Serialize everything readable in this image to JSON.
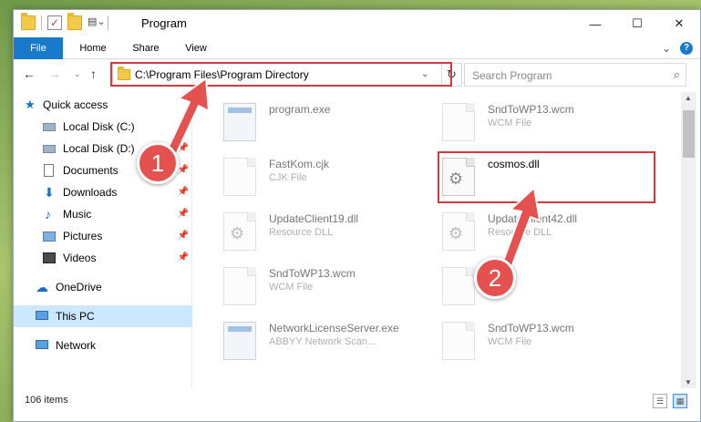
{
  "window": {
    "title": "Program",
    "controls": {
      "minimize": "—",
      "maximize": "☐",
      "close": "✕"
    }
  },
  "ribbon": {
    "tabs": [
      "File",
      "Home",
      "Share",
      "View"
    ],
    "expand_glyph": "⌄",
    "help_glyph": "?"
  },
  "nav": {
    "back": "←",
    "forward": "→",
    "recent": "⌄",
    "up": "↑",
    "address": "C:\\Program Files\\Program Directory",
    "address_chevron": "⌄",
    "refresh": "↻",
    "search_placeholder": "Search Program",
    "search_glyph": "⌕"
  },
  "sidebar": {
    "items": [
      {
        "label": "Quick access",
        "icon": "star-icon",
        "pinned": false
      },
      {
        "label": "Local Disk (C:)",
        "icon": "drive-icon",
        "pinned": true
      },
      {
        "label": "Local Disk (D:)",
        "icon": "drive-icon",
        "pinned": true
      },
      {
        "label": "Documents",
        "icon": "documents-icon",
        "pinned": true
      },
      {
        "label": "Downloads",
        "icon": "download-icon",
        "pinned": true
      },
      {
        "label": "Music",
        "icon": "music-icon",
        "pinned": true
      },
      {
        "label": "Pictures",
        "icon": "pictures-icon",
        "pinned": true
      },
      {
        "label": "Videos",
        "icon": "videos-icon",
        "pinned": true
      },
      {
        "label": "OneDrive",
        "icon": "cloud-icon",
        "pinned": false
      },
      {
        "label": "This PC",
        "icon": "computer-icon",
        "pinned": false,
        "selected": true
      },
      {
        "label": "Network",
        "icon": "network-icon",
        "pinned": false
      }
    ],
    "pin_glyph": "📌"
  },
  "files": [
    {
      "name": "program.exe",
      "type": ""
    },
    {
      "name": "SndToWP13.wcm",
      "type": "WCM File"
    },
    {
      "name": "FastKom.cjk",
      "type": "CJK File"
    },
    {
      "name": "cosmos.dll",
      "type": ""
    },
    {
      "name": "UpdateClient19.dll",
      "type": "Resource DLL"
    },
    {
      "name": "UpdateClient42.dll",
      "type": "Resource DLL"
    },
    {
      "name": "SndToWP13.wcm",
      "type": "WCM File"
    },
    {
      "name": "",
      "type": ""
    },
    {
      "name": "NetworkLicenseServer.exe",
      "type": "ABBYY Network Scan..."
    },
    {
      "name": "SndToWP13.wcm",
      "type": "WCM File"
    }
  ],
  "status": {
    "item_count": "106 items"
  },
  "annotations": {
    "step1": "1",
    "step2": "2"
  },
  "colors": {
    "accent": "#1979ca",
    "highlight": "#d5383e",
    "badge": "#e5514e",
    "selected": "#cce8ff"
  }
}
